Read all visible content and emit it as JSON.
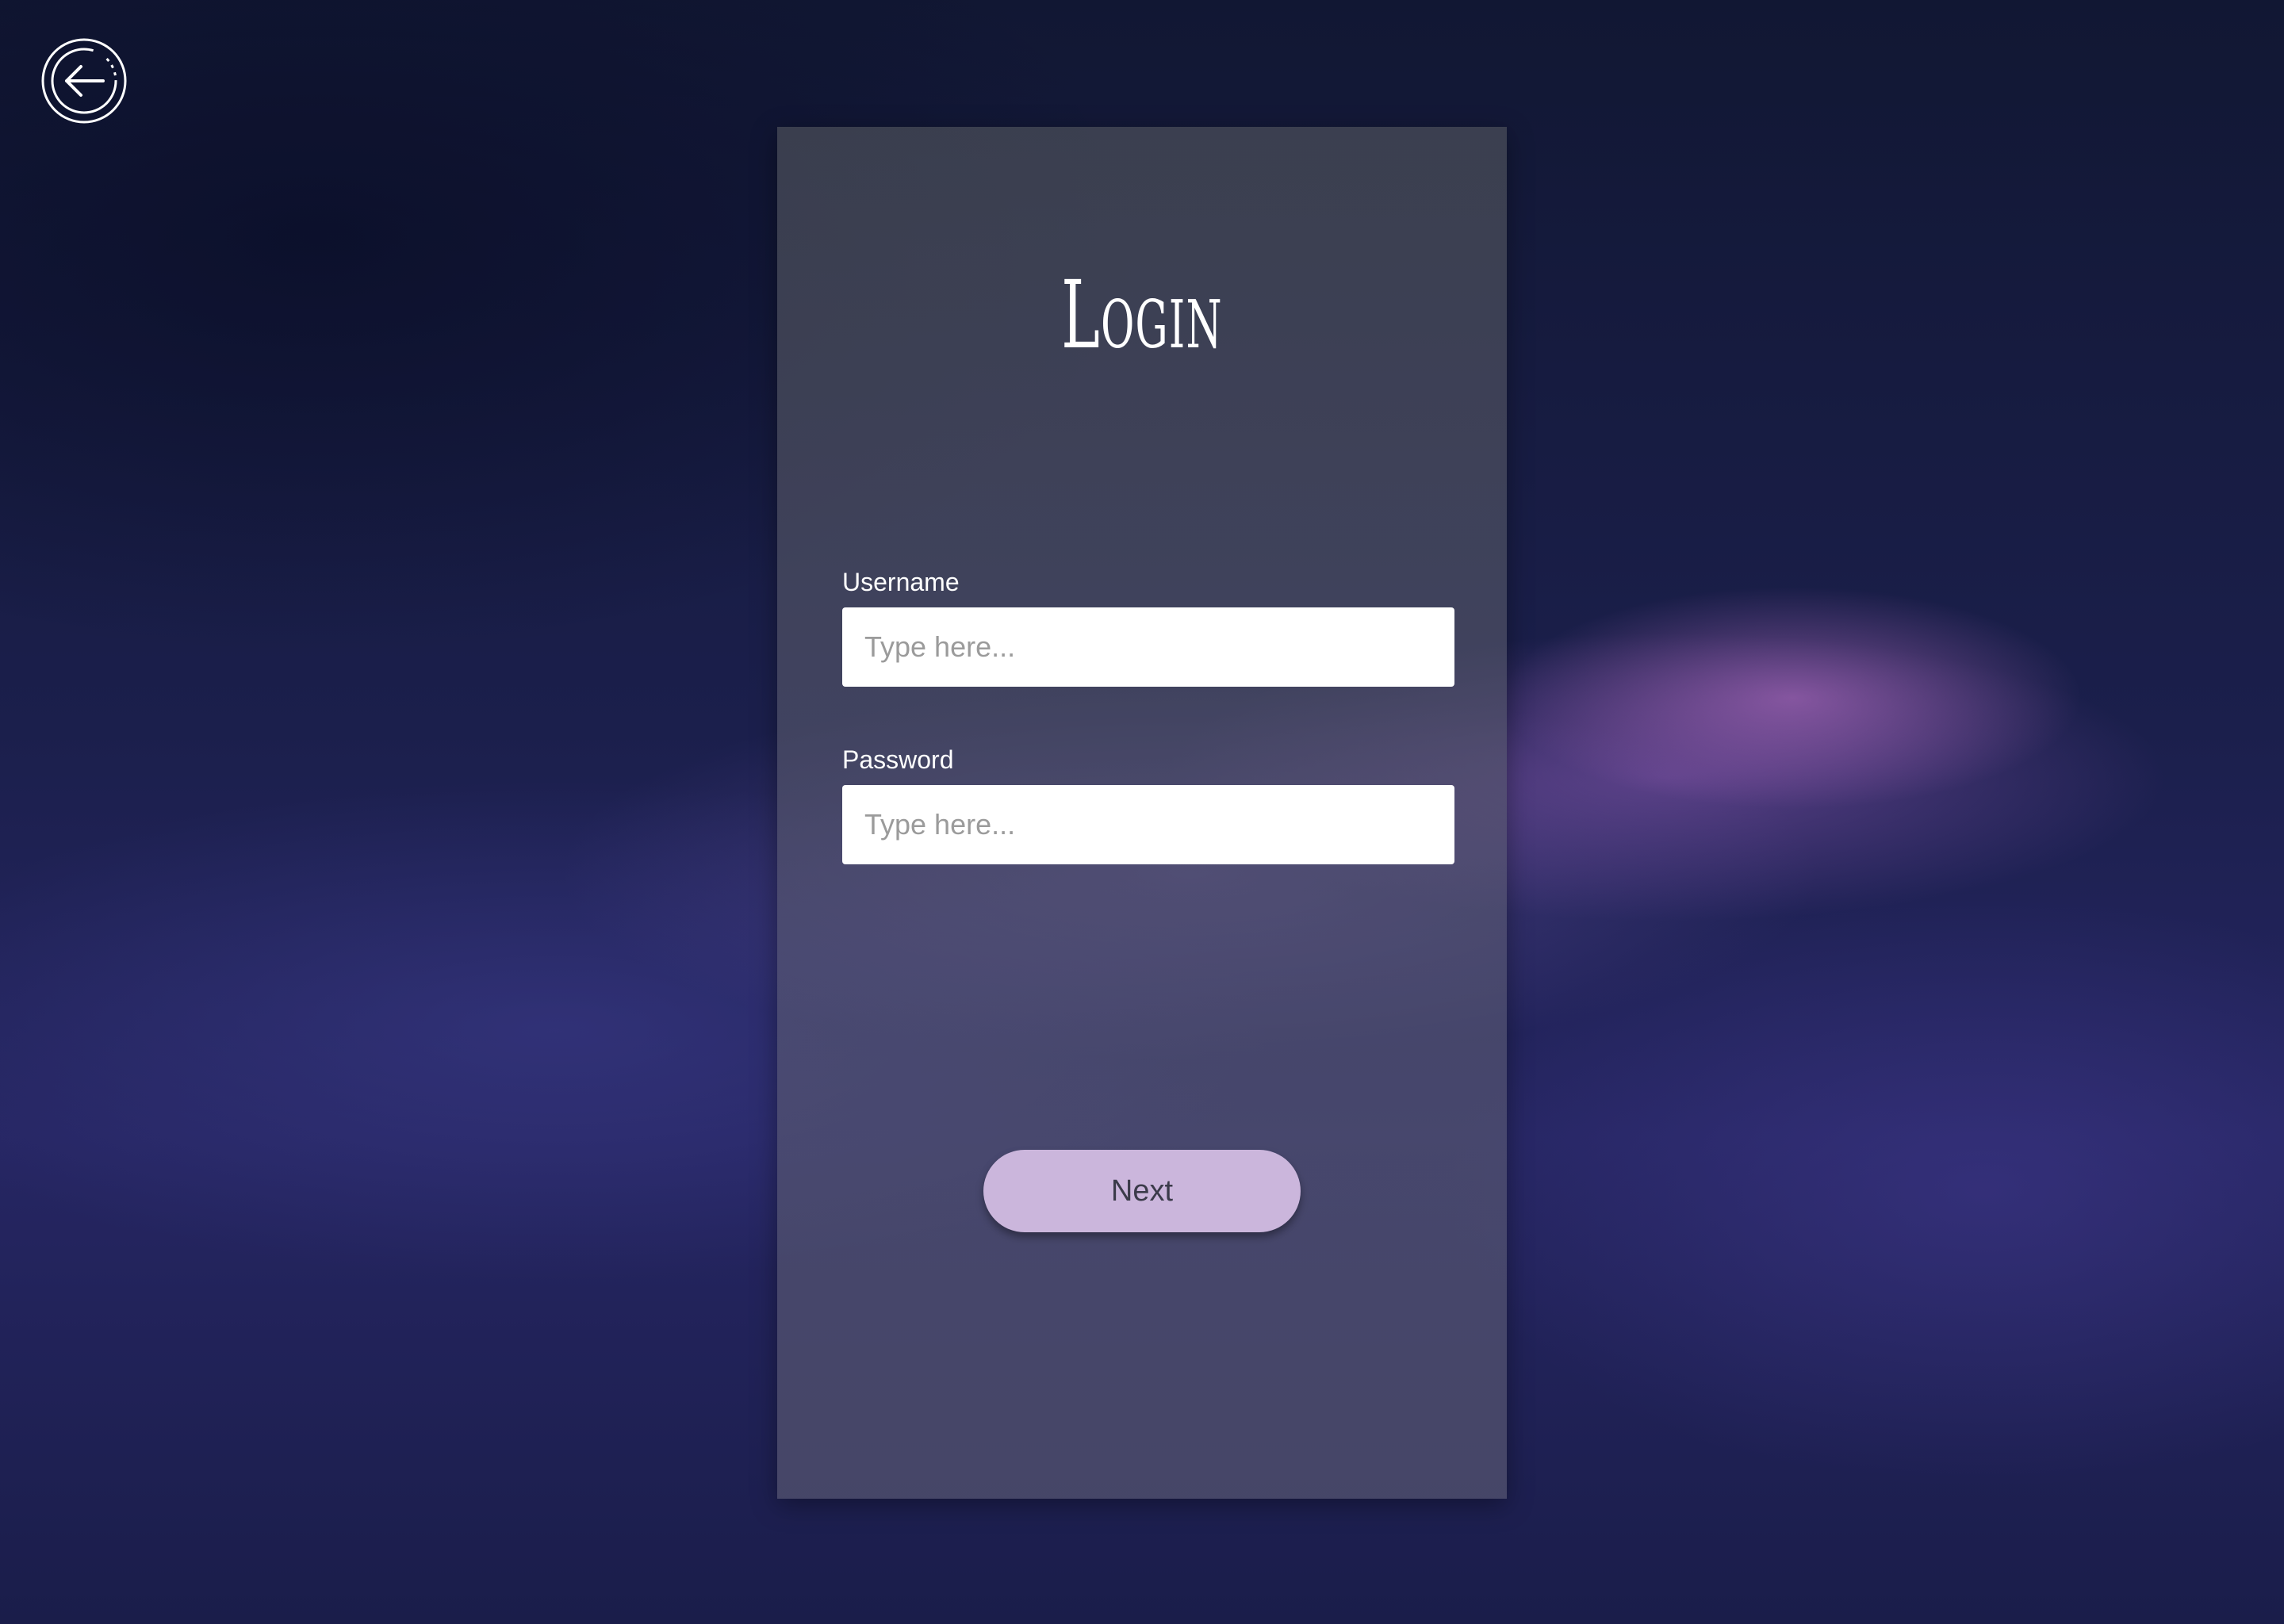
{
  "back_button": {
    "icon": "arrow-left-icon"
  },
  "login": {
    "title": "Login",
    "username": {
      "label": "Username",
      "placeholder": "Type here...",
      "value": ""
    },
    "password": {
      "label": "Password",
      "placeholder": "Type here...",
      "value": ""
    },
    "next_label": "Next"
  },
  "colors": {
    "background": "#141a3a",
    "card": "#4e5064",
    "button": "#cbb6dc",
    "button_text": "#3b3b4a",
    "input_bg": "#ffffff",
    "placeholder": "#9b9b9b"
  }
}
